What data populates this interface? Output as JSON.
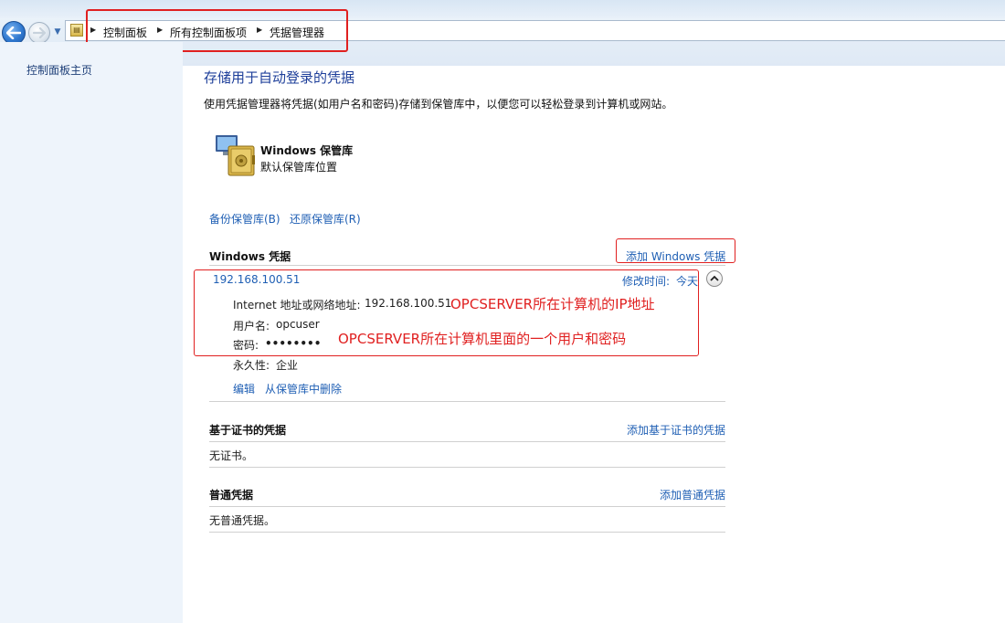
{
  "breadcrumb": {
    "items": [
      "控制面板",
      "所有控制面板项",
      "凭据管理器"
    ]
  },
  "left_pane": {
    "home_link": "控制面板主页"
  },
  "main": {
    "title": "存储用于自动登录的凭据",
    "description": "使用凭据管理器将凭据(如用户名和密码)存储到保管库中，以便您可以轻松登录到计算机或网站。",
    "vault": {
      "name": "Windows 保管库",
      "subtitle": "默认保管库位置"
    },
    "backup_link": "备份保管库(B)",
    "restore_link": "还原保管库(R)",
    "windows_credentials": {
      "title": "Windows 凭据",
      "add_link": "添加 Windows 凭据",
      "entry": {
        "name": "192.168.100.51",
        "modified_label": "修改时间:",
        "modified_value": "今天",
        "address_label": "Internet 地址或网络地址:",
        "address_value": "192.168.100.51",
        "user_label": "用户名:",
        "user_value": "opcuser",
        "password_label": "密码:",
        "password_value": "••••••••",
        "persistence_label": "永久性:",
        "persistence_value": "企业",
        "edit_link": "编辑",
        "delete_link": "从保管库中删除"
      }
    },
    "certificate_credentials": {
      "title": "基于证书的凭据",
      "add_link": "添加基于证书的凭据",
      "empty_text": "无证书。"
    },
    "generic_credentials": {
      "title": "普通凭据",
      "add_link": "添加普通凭据",
      "empty_text": "无普通凭据。"
    }
  },
  "annotations": {
    "ip_note": "OPCSERVER所在计算机的IP地址",
    "user_note": "OPCSERVER所在计算机里面的一个用户和密码",
    "color": "#e02020"
  },
  "icons": [
    "back-arrow-icon",
    "forward-arrow-icon",
    "control-panel-icon",
    "credential-vault-icon",
    "collapse-chevron-icon"
  ]
}
